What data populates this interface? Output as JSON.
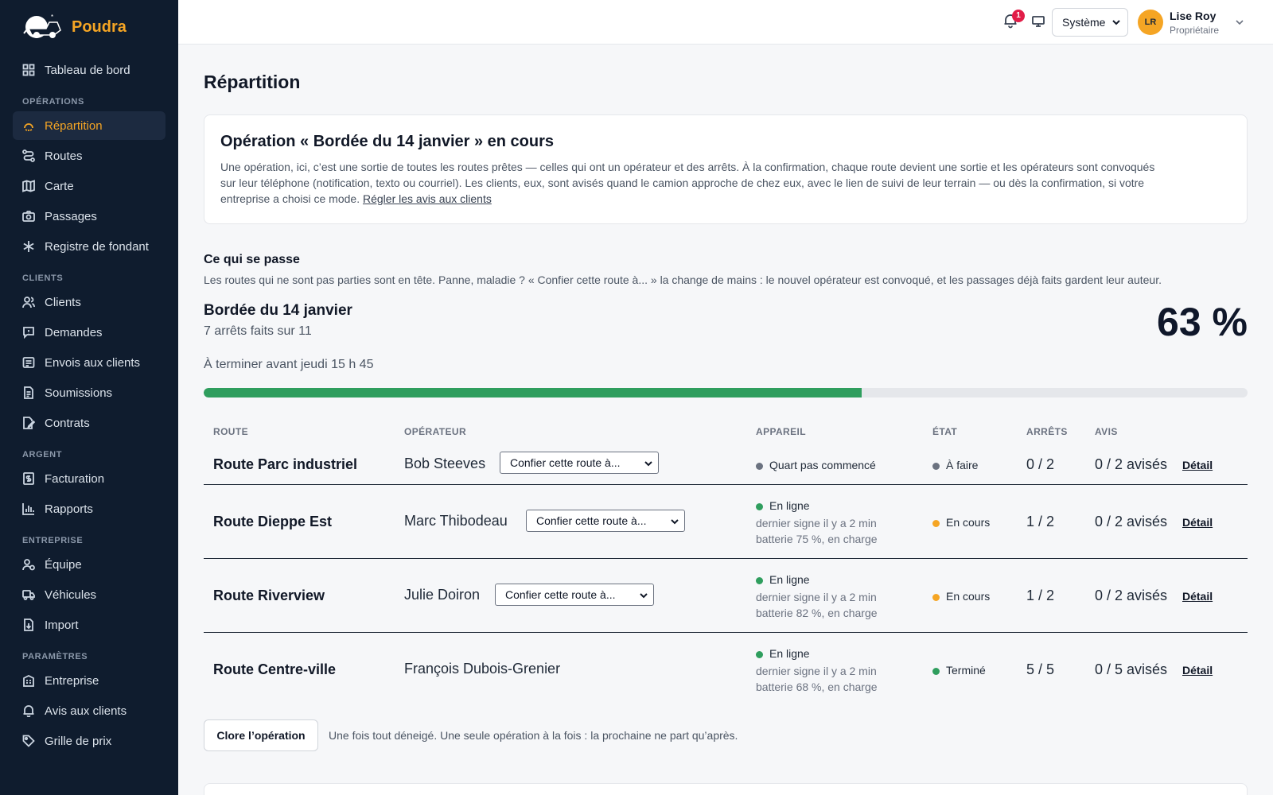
{
  "brand": {
    "name": "Poudra"
  },
  "sidebar": {
    "top_item": {
      "label": "Tableau de bord",
      "icon": "dashboard-icon"
    },
    "sections": [
      {
        "title": "OPÉRATIONS",
        "items": [
          {
            "label": "Répartition",
            "icon": "dispatch-icon",
            "active": true
          },
          {
            "label": "Routes",
            "icon": "route-icon"
          },
          {
            "label": "Carte",
            "icon": "map-icon"
          },
          {
            "label": "Passages",
            "icon": "camera-icon"
          },
          {
            "label": "Registre de fondant",
            "icon": "snowflake-icon"
          }
        ]
      },
      {
        "title": "CLIENTS",
        "items": [
          {
            "label": "Clients",
            "icon": "users-icon"
          },
          {
            "label": "Demandes",
            "icon": "message-icon"
          },
          {
            "label": "Envois aux clients",
            "icon": "send-icon"
          },
          {
            "label": "Soumissions",
            "icon": "document-icon"
          },
          {
            "label": "Contrats",
            "icon": "contract-icon"
          }
        ]
      },
      {
        "title": "ARGENT",
        "items": [
          {
            "label": "Facturation",
            "icon": "invoice-icon"
          },
          {
            "label": "Rapports",
            "icon": "chart-icon"
          }
        ]
      },
      {
        "title": "ENTREPRISE",
        "items": [
          {
            "label": "Équipe",
            "icon": "team-icon"
          },
          {
            "label": "Véhicules",
            "icon": "truck-icon"
          },
          {
            "label": "Import",
            "icon": "import-icon"
          }
        ]
      },
      {
        "title": "PARAMÈTRES",
        "items": [
          {
            "label": "Entreprise",
            "icon": "building-icon"
          },
          {
            "label": "Avis aux clients",
            "icon": "bell-icon"
          },
          {
            "label": "Grille de prix",
            "icon": "tag-icon"
          }
        ]
      }
    ]
  },
  "topbar": {
    "notification_count": "1",
    "theme_value": "Système",
    "user": {
      "initials": "LR",
      "name": "Lise Roy",
      "role": "Propriétaire"
    }
  },
  "page": {
    "title": "Répartition"
  },
  "operation": {
    "title": "Opération « Bordée du 14 janvier » en cours",
    "description_line1": "Une opération, ici, c’est une sortie de toutes les routes prêtes — celles qui ont un opérateur et des arrêts. À la confirmation, chaque route devient une sortie et les opérateurs sont convoqués",
    "description_line2": "sur leur téléphone (notification, texto ou courriel). Les clients, eux, sont avisés quand le camion approche de chez eux, avec le lien de suivi de leur terrain — ou dès la confirmation, si votre",
    "description_line3": "entreprise a choisi ce mode.",
    "link_label": "Régler les avis aux clients"
  },
  "happening": {
    "title": "Ce qui se passe",
    "description": "Les routes qui ne sont pas parties sont en tête. Panne, maladie ? « Confier cette route à... » la change de mains : le nouvel opérateur est convoqué, et les passages déjà faits gardent leur auteur."
  },
  "summary": {
    "name": "Bordée du 14 janvier",
    "count_text": "7 arrêts faits sur 11",
    "deadline": "À terminer avant jeudi 15 h 45",
    "percent_text": "63 %",
    "progress": 0.63
  },
  "table": {
    "headers": {
      "route": "ROUTE",
      "operator": "OPÉRATEUR",
      "device": "APPAREIL",
      "state": "ÉTAT",
      "stops": "ARRÊTS",
      "notices": "AVIS"
    },
    "assign_placeholder": "Confier cette route à...",
    "detail_label": "Détail",
    "rows": [
      {
        "route": "Route Parc industriel",
        "operator": "Bob Steeves",
        "has_assign": true,
        "device_status": "Quart pas commencé",
        "device_dot": "gray",
        "device_sub1": "",
        "device_sub2": "",
        "state": "À faire",
        "state_dot": "gray",
        "stops": "0 / 2",
        "notices": "0 / 2 avisés"
      },
      {
        "route": "Route Dieppe Est",
        "operator": "Marc Thibodeau",
        "has_assign": true,
        "device_status": "En ligne",
        "device_dot": "green",
        "device_sub1": "dernier signe il y a 2 min",
        "device_sub2": "batterie 75 %, en charge",
        "state": "En cours",
        "state_dot": "amber",
        "stops": "1 / 2",
        "notices": "0 / 2 avisés"
      },
      {
        "route": "Route Riverview",
        "operator": "Julie Doiron",
        "has_assign": true,
        "device_status": "En ligne",
        "device_dot": "green",
        "device_sub1": "dernier signe il y a 2 min",
        "device_sub2": "batterie 82 %, en charge",
        "state": "En cours",
        "state_dot": "amber",
        "stops": "1 / 2",
        "notices": "0 / 2 avisés"
      },
      {
        "route": "Route Centre-ville",
        "operator": "François Dubois-Grenier",
        "has_assign": false,
        "device_status": "En ligne",
        "device_dot": "green",
        "device_sub1": "dernier signe il y a 2 min",
        "device_sub2": "batterie 68 %, en charge",
        "state": "Terminé",
        "state_dot": "green",
        "stops": "5 / 5",
        "notices": "0 / 5 avisés"
      }
    ]
  },
  "close": {
    "button_label": "Clore l’opération",
    "note": "Une fois tout déneigé. Une seule opération à la fois : la prochaine ne part qu’après."
  }
}
